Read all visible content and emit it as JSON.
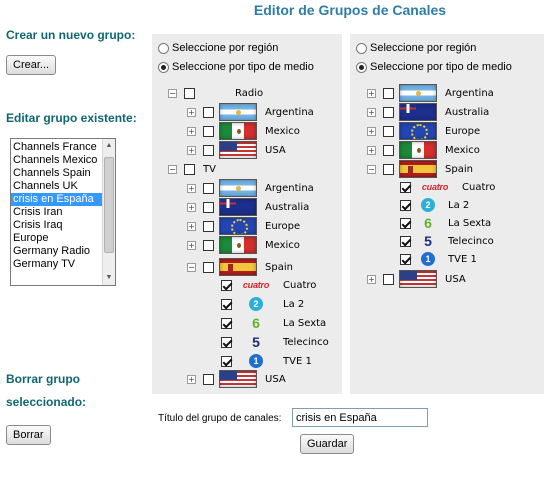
{
  "page": {
    "title": "Editor de Grupos de Canales"
  },
  "left": {
    "new_group_label": "Crear un nuevo grupo:",
    "create_button": "Crear...",
    "edit_group_label": "Editar grupo existente:",
    "groups": [
      "Channels France",
      "Channels Mexico",
      "Channels Spain",
      "Channels UK",
      "crisis en España",
      "Crisis Iran",
      "Crisis Iraq",
      "Europe",
      "Germany Radio",
      "Germany TV"
    ],
    "selected_group_index": 4,
    "delete_label_line1": "Borrar grupo",
    "delete_label_line2": "seleccionado:",
    "delete_button": "Borrar"
  },
  "left_panel": {
    "radio_region": "Seleccione por región",
    "radio_media": "Seleccione por tipo de medio",
    "selected_radio": "media",
    "radio_node": "Radio",
    "radio_countries": [
      "Argentina",
      "Mexico",
      "USA"
    ],
    "tv_node": "TV",
    "tv_countries": [
      "Argentina",
      "Australia",
      "Europe",
      "Mexico",
      "Spain"
    ],
    "spain_channels": [
      "Cuatro",
      "La 2",
      "La Sexta",
      "Telecinco",
      "TVE 1"
    ],
    "tv_last_country": "USA"
  },
  "right_panel": {
    "radio_region": "Seleccione por región",
    "radio_media": "Seleccione por tipo de medio",
    "selected_radio": "media",
    "countries": [
      "Argentina",
      "Australia",
      "Europe",
      "Mexico",
      "Spain"
    ],
    "spain_channels": [
      "Cuatro",
      "La 2",
      "La Sexta",
      "Telecinco",
      "TVE 1"
    ],
    "last_country": "USA"
  },
  "logos": {
    "cuatro": "cuatro",
    "la2": "2",
    "lasexta": "6",
    "telecinco": "5",
    "tve1": "1"
  },
  "footer": {
    "name_label": "Título del grupo de canales:",
    "name_value": "crisis en España",
    "save_button": "Guardar"
  },
  "colors": {
    "title": "#2e7da8",
    "section_labels": "#0e6770",
    "panel_bg": "#ececec",
    "list_selection": "#3399ff",
    "cuatro_red": "#d8232a",
    "la2_cyan": "#2bb0d9",
    "lasexta_green": "#62b22f",
    "telecinco_navy": "#1b2d7a",
    "tve1_blue": "#1f6fd0"
  },
  "icons": {
    "expand": "plus-box-icon",
    "collapse": "minus-box-icon",
    "checkbox": "checkbox-icon",
    "radio": "radio-button-icon"
  }
}
